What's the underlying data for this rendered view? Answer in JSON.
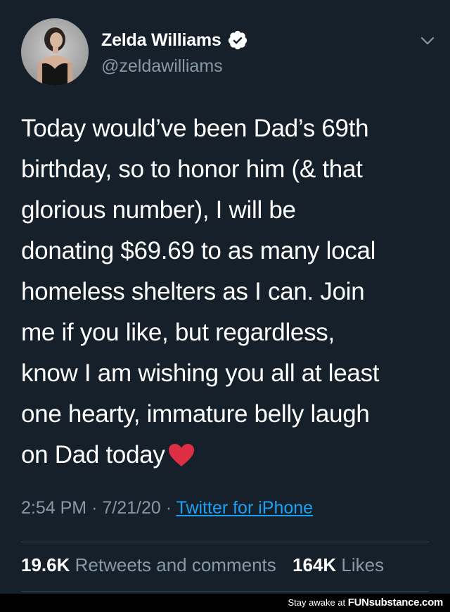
{
  "user": {
    "display_name": "Zelda Williams",
    "handle": "@zeldawilliams",
    "verified": true
  },
  "tweet": {
    "lines": [
      "Today would’ve been Dad’s 69th",
      "birthday, so to honor him (& that",
      "glorious number), I will be",
      "donating $69.69 to as many local",
      "homeless shelters as I can. Join",
      "me if you like, but regardless,",
      "know I am wishing you all at least",
      "one hearty, immature belly laugh",
      "on Dad today"
    ],
    "emoji": "red-heart"
  },
  "meta": {
    "time": "2:54 PM",
    "separator": "·",
    "date": "7/21/20",
    "source": "Twitter for iPhone"
  },
  "stats": {
    "retweets_count": "19.6K",
    "retweets_label": "Retweets and comments",
    "likes_count": "164K",
    "likes_label": "Likes"
  },
  "watermark": {
    "prefix": "Stay awake at",
    "brand": "FUNsubstance.com"
  },
  "colors": {
    "background": "#15202b",
    "text": "#ffffff",
    "secondary": "#8899a6",
    "link": "#1da1f2",
    "verified": "#ffffff",
    "heart": "#dd2e44",
    "divider": "#38444d"
  },
  "icons": {
    "verified": "verified-badge-icon",
    "chevron": "chevron-down-icon",
    "heart": "red-heart-emoji"
  }
}
